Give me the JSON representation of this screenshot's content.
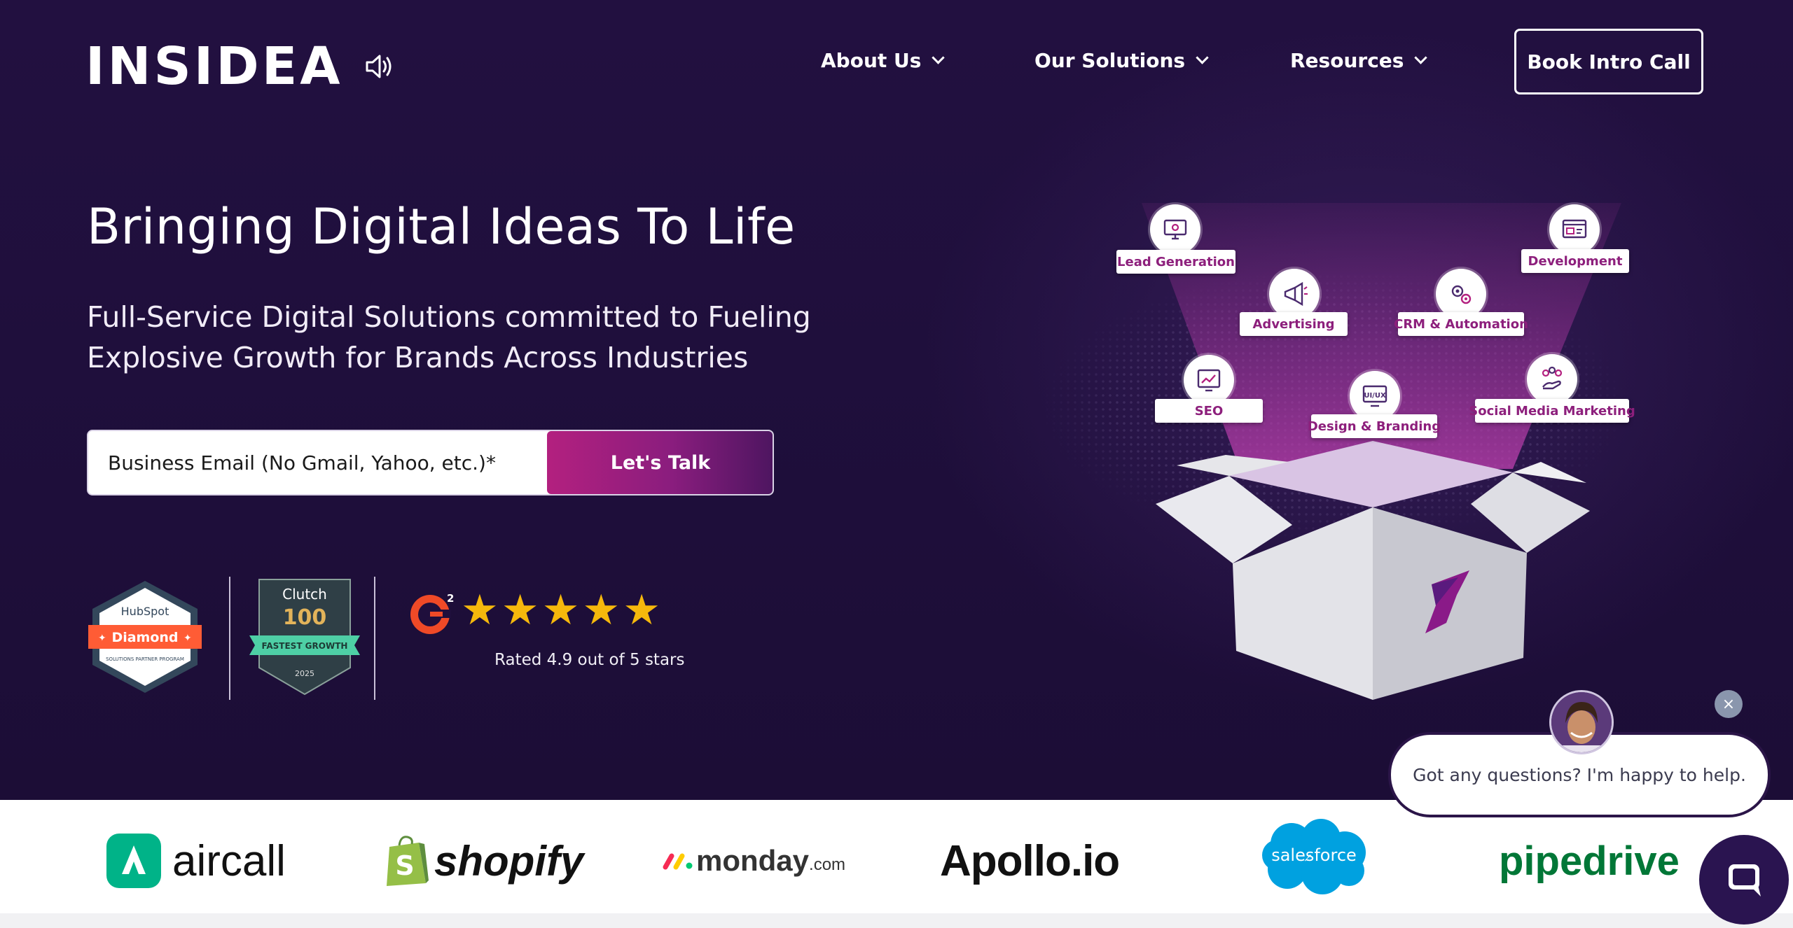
{
  "header": {
    "logo_text": "INSIDEA",
    "nav": [
      {
        "label": "About Us"
      },
      {
        "label": "Our Solutions"
      },
      {
        "label": "Resources"
      }
    ],
    "cta_label": "Book Intro Call"
  },
  "hero": {
    "headline": "Bringing Digital Ideas To Life",
    "subline_1": "Full-Service Digital Solutions committed to Fueling",
    "subline_2": "Explosive Growth for Brands Across Industries",
    "email_placeholder": "Business Email (No Gmail, Yahoo, etc.)*",
    "submit_label": "Let's Talk"
  },
  "badges": {
    "hubspot": {
      "brand": "HubSpot",
      "tier": "Diamond",
      "program": "SOLUTIONS PARTNER PROGRAM"
    },
    "clutch": {
      "brand": "Clutch",
      "rank": "100",
      "ribbon": "FASTEST GROWTH",
      "year": "2025"
    },
    "g2": {
      "brand": "G2",
      "stars": 5,
      "rating_text": "Rated 4.9 out of 5 stars"
    }
  },
  "services": [
    {
      "label": "Lead Generation",
      "icon": "monitor-gear-icon"
    },
    {
      "label": "Development",
      "icon": "code-window-icon"
    },
    {
      "label": "Advertising",
      "icon": "megaphone-icon"
    },
    {
      "label": "CRM & Automation",
      "icon": "gears-icon"
    },
    {
      "label": "SEO",
      "icon": "seo-chart-icon"
    },
    {
      "label": "Design & Branding",
      "icon": "uiux-monitor-icon"
    },
    {
      "label": "Social Media Marketing",
      "icon": "network-hand-icon"
    }
  ],
  "illustration": {
    "box_logo": "S"
  },
  "chat": {
    "close_label": "×",
    "message": "Got any questions? I'm happy to help."
  },
  "clients": [
    {
      "name": "aircall"
    },
    {
      "name": "shopify"
    },
    {
      "name": "monday",
      "suffix": ".com"
    },
    {
      "name": "Apollo.io"
    },
    {
      "name": "salesforce"
    },
    {
      "name": "pipedrive"
    }
  ],
  "colors": {
    "background": "#1f0f3c",
    "accent": "#b3207f",
    "star": "#f5b80c",
    "service_text": "#8d1f7c"
  }
}
